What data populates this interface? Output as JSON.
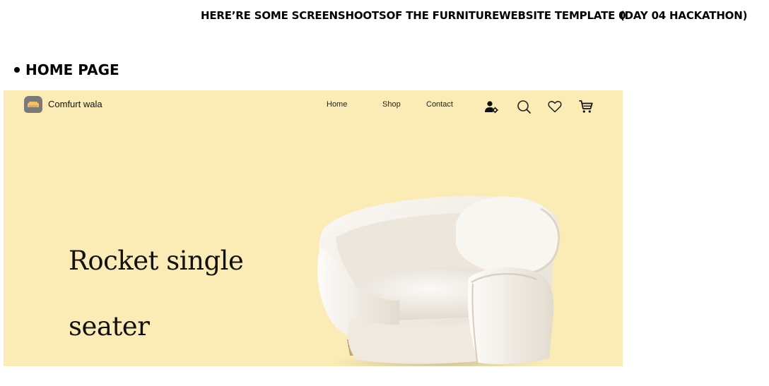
{
  "document": {
    "heading_main": "HERE’RE SOME SCREENSHOOTSOF THE FURNITUREWEBSITE TEMPLATE 0",
    "heading_tag": "(DAY 04 HACKATHON)",
    "section_label": "HOME PAGE"
  },
  "site": {
    "brand": "Comfurt wala",
    "nav": {
      "home": "Home",
      "shop": "Shop",
      "contact": "Contact"
    },
    "icons": [
      "account-settings-icon",
      "search-icon",
      "heart-icon",
      "cart-icon"
    ],
    "hero": {
      "line1": "Rocket single",
      "line2": "seater"
    },
    "colors": {
      "background": "#fbebb5",
      "logo": "#7a7a7a",
      "logo_accent": "#f3c066"
    }
  }
}
